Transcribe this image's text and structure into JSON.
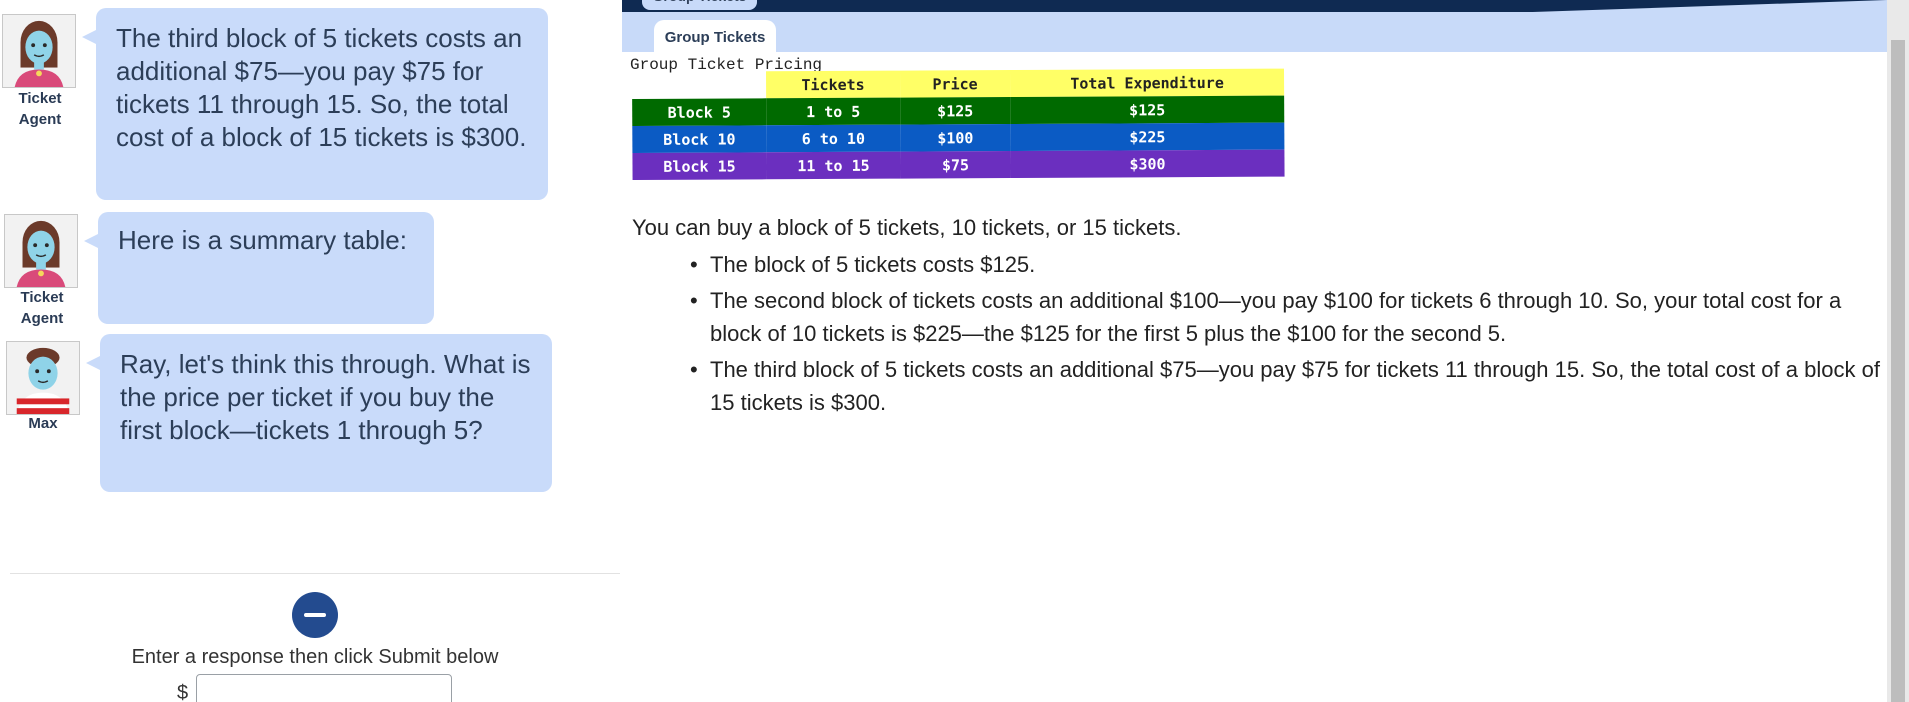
{
  "chat": {
    "messages": [
      {
        "speaker": "Ticket Agent",
        "avatar_icon": "female-agent-avatar",
        "name_line1": "Ticket",
        "name_line2": "Agent",
        "text": "The third block of 5 tickets costs an additional $75—you pay $75 for tickets 11 through 15.  So, the total cost of a block of 15 tickets is $300."
      },
      {
        "speaker": "Ticket Agent",
        "avatar_icon": "female-agent-avatar",
        "name_line1": "Ticket",
        "name_line2": "Agent",
        "text": "Here is a summary table:"
      },
      {
        "speaker": "Max",
        "avatar_icon": "student-avatar",
        "name_line1": "Max",
        "name_line2": "",
        "text": "Ray, let's think this through.  What is the price per ticket if you buy the first block—tickets 1 through 5?"
      }
    ],
    "collapse_icon": "minus-icon",
    "response_prompt": "Enter a response then click Submit below",
    "currency_symbol": "$",
    "response_value": ""
  },
  "doc": {
    "tab_ghost_label": "Group Tickets",
    "tab_label": "Group Tickets",
    "pricing": {
      "title": "Group Ticket Pricing",
      "headers": [
        "Tickets",
        "Price",
        "Total Expenditure"
      ],
      "rows": [
        {
          "block": "Block 5",
          "tickets": "1 to 5",
          "price": "$125",
          "total": "$125",
          "color": "#006a00"
        },
        {
          "block": "Block 10",
          "tickets": "6 to 10",
          "price": "$100",
          "total": "$225",
          "color": "#0b5bc4"
        },
        {
          "block": "Block 15",
          "tickets": "11 to 15",
          "price": "$75",
          "total": "$300",
          "color": "#6b2fbf"
        }
      ],
      "header_color": "#ffff66"
    },
    "intro": "You can buy a block of 5 tickets, 10 tickets, or 15 tickets.",
    "bullets": [
      "The block of 5 tickets costs $125.",
      "The second block of tickets costs an additional $100—you pay $100 for tickets 6 through 10. So, your total cost for a block of 10 tickets is $225—the $125 for the first 5 plus the $100 for the second 5.",
      "The third block of 5 tickets costs an additional $75—you pay $75 for tickets 11 through 15. So, the total cost of a block of 15 tickets is $300."
    ]
  },
  "colors": {
    "bubble": "#c9dbfa",
    "tab_bar": "#c8daf9",
    "navy": "#0f2a52",
    "button": "#234b8f"
  }
}
